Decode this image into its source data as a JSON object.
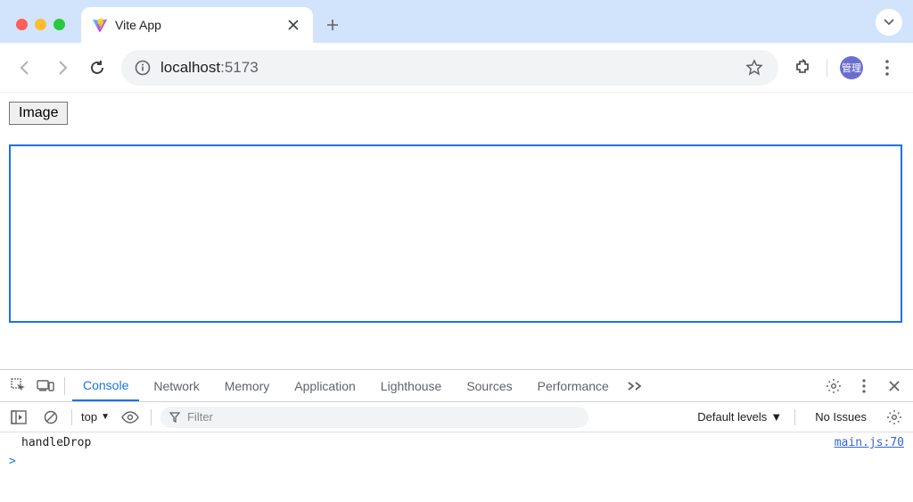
{
  "browser": {
    "tab_title": "Vite App",
    "url_host": "localhost",
    "url_port": ":5173"
  },
  "page": {
    "image_button_label": "Image"
  },
  "devtools": {
    "tabs": [
      "Console",
      "Network",
      "Memory",
      "Application",
      "Lighthouse",
      "Sources",
      "Performance"
    ],
    "active_tab": "Console",
    "context": "top",
    "filter_placeholder": "Filter",
    "levels_label": "Default levels",
    "issues_label": "No Issues",
    "log_message": "handleDrop",
    "log_source": "main.js:70",
    "prompt": ">"
  },
  "avatar_label": "管理"
}
